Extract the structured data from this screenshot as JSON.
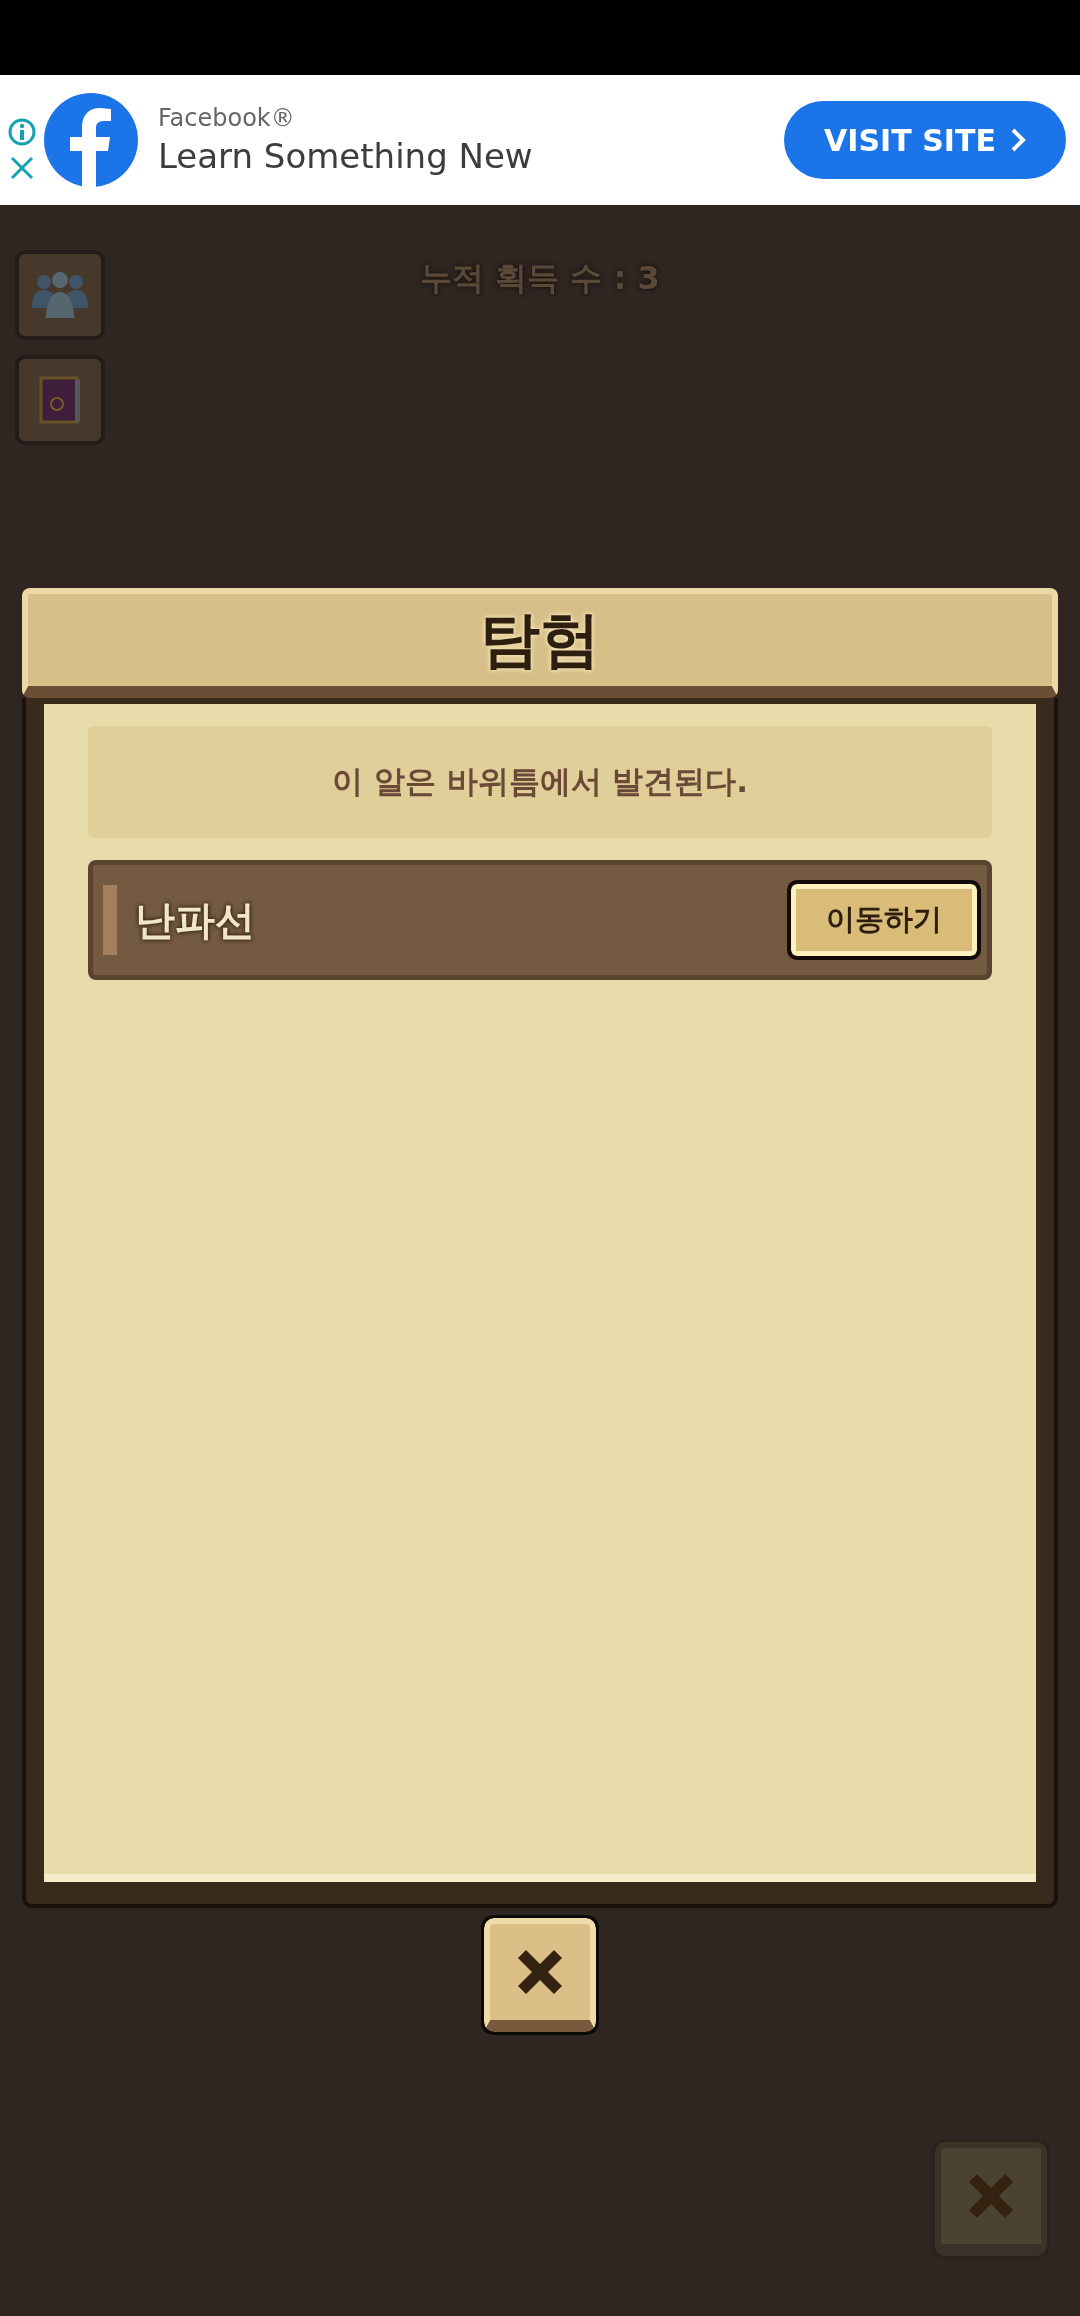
{
  "ad": {
    "brand": "Facebook®",
    "headline": "Learn Something New",
    "button": "VISIT SITE"
  },
  "counter": "누적 획득 수 : 3",
  "dialog": {
    "title": "탐험",
    "message": "이 알은 바위틈에서 발견된다.",
    "locations": [
      {
        "name": "난파선",
        "button": "이동하기"
      }
    ]
  }
}
